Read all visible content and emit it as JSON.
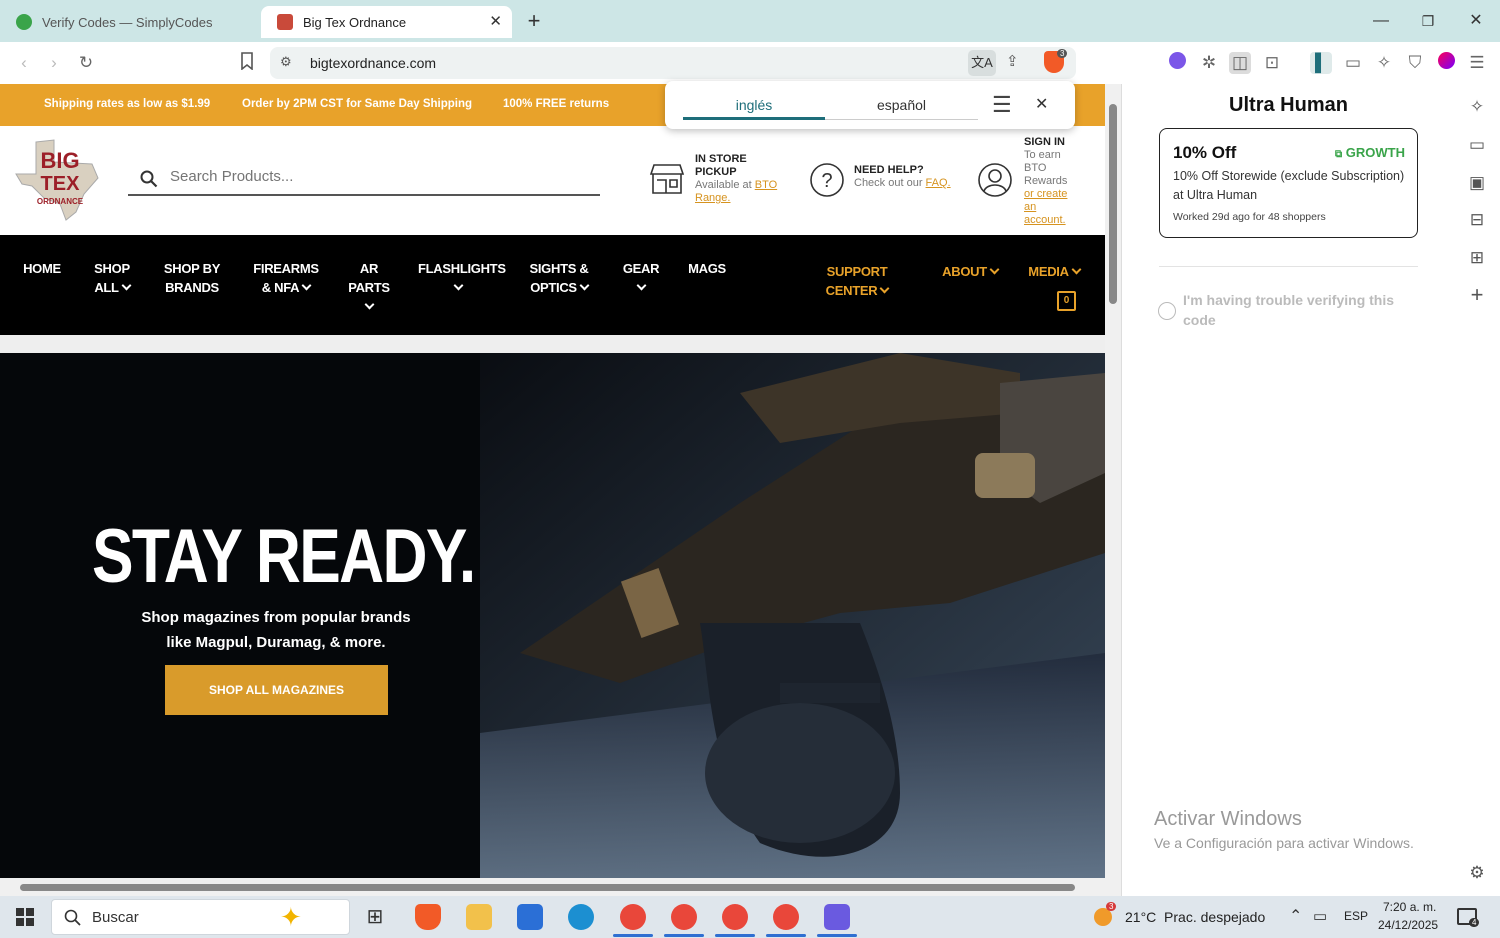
{
  "tabs": [
    {
      "title": "Verify Codes — SimplyCodes",
      "favicon": "simplycodes-icon",
      "active": false
    },
    {
      "title": "Big Tex Ordnance",
      "favicon": "bigtex-icon",
      "active": true
    }
  ],
  "browser": {
    "url": "bigtexordnance.com",
    "shields_count": "3"
  },
  "translate": {
    "source_lang": "inglés",
    "target_lang": "español"
  },
  "site": {
    "promo": [
      "Shipping rates as low as $1.99",
      "Order by 2PM CST for Same Day Shipping",
      "100% FREE returns"
    ],
    "logo_lines": [
      "BIG",
      "TEX",
      "ORDNANCE"
    ],
    "search_placeholder": "Search Products...",
    "pickup": {
      "title": "IN STORE PICKUP",
      "text": "Available at ",
      "link": "BTO Range."
    },
    "help": {
      "title": "NEED HELP?",
      "text": "Check out our ",
      "link": "FAQ."
    },
    "signin": {
      "title": "SIGN IN",
      "text": "To earn BTO Rewards ",
      "link": "or create an account."
    },
    "nav": [
      {
        "l1": "HOME",
        "l2": ""
      },
      {
        "l1": "SHOP",
        "l2": "ALL"
      },
      {
        "l1": "SHOP BY",
        "l2": "BRANDS"
      },
      {
        "l1": "FIREARMS",
        "l2": "& NFA"
      },
      {
        "l1": "AR",
        "l2": "PARTS"
      },
      {
        "l1": "FLASHLIGHTS",
        "l2": ""
      },
      {
        "l1": "SIGHTS &",
        "l2": "OPTICS"
      },
      {
        "l1": "GEAR",
        "l2": ""
      },
      {
        "l1": "MAGS",
        "l2": ""
      },
      {
        "l1": "SUPPORT CENTER",
        "l2": ""
      },
      {
        "l1": "ABOUT",
        "l2": ""
      },
      {
        "l1": "MEDIA",
        "l2": ""
      }
    ],
    "cart_count": "0",
    "hero": {
      "title": "STAY READY.",
      "sub1": "Shop magazines from popular brands",
      "sub2": "like Magpul, Duramag, & more.",
      "button": "SHOP ALL MAGAZINES"
    }
  },
  "panel": {
    "title": "Ultra Human",
    "coupon": {
      "discount": "10% Off",
      "badge": "GROWTH",
      "desc": "10% Off Storewide (exclude Subscription) at Ultra Human",
      "meta": "Worked 29d ago for 48 shoppers"
    },
    "trouble": "I'm having trouble verifying this code",
    "watermark_title": "Activar Windows",
    "watermark_sub": "Ve a Configuración para activar Windows."
  },
  "taskbar": {
    "search": "Buscar",
    "weather": "21°C  Prac. despejado",
    "weather_badge": "3",
    "lang": "ESP",
    "time": "7:20 a. m.",
    "date": "24/12/2025",
    "notif_count": "4"
  },
  "colors": {
    "accent": "#e8a22a",
    "tabbar": "#cde6e6",
    "panel_green": "#3aa44a"
  }
}
